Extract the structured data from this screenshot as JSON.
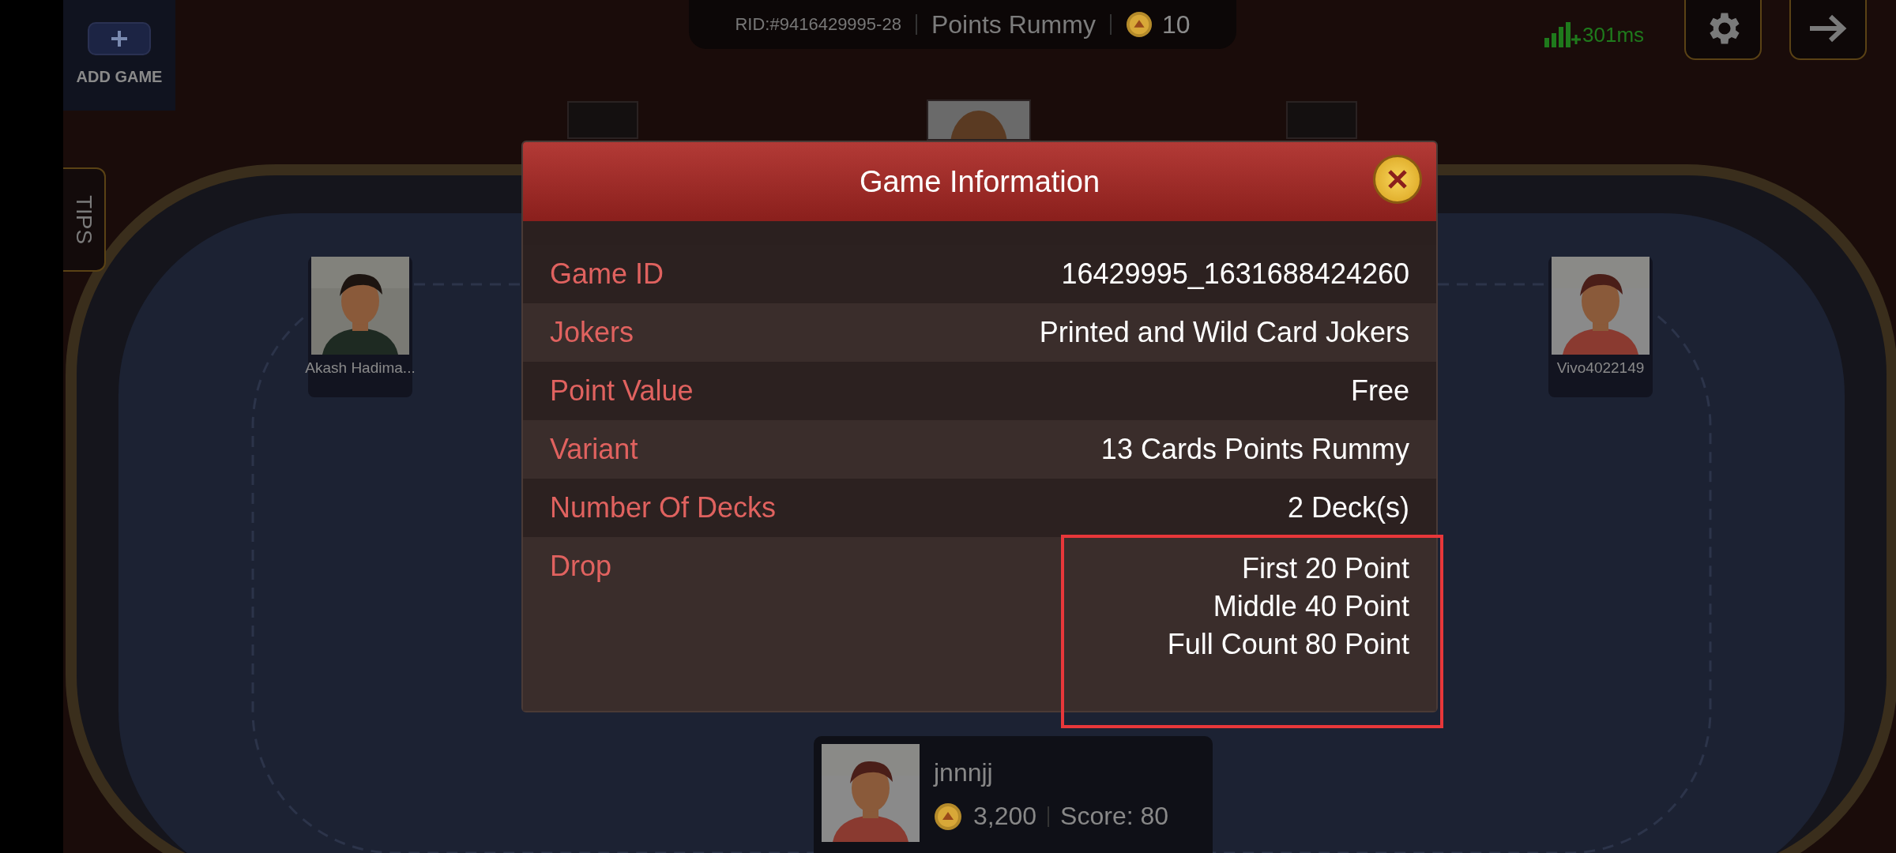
{
  "top_bar": {
    "room_id": "RID:#9416429995-28",
    "game_type": "Points Rummy",
    "coins": "10"
  },
  "add_game": {
    "label": "ADD GAME"
  },
  "tips_tab": {
    "label": "TIPS"
  },
  "network": {
    "latency": "301ms"
  },
  "top_seats": [
    {
      "kind": "empty"
    },
    {
      "kind": "avatar"
    },
    {
      "kind": "empty"
    }
  ],
  "players": [
    {
      "name": "Akash Hadima..."
    },
    {
      "name": "Vivo4022149",
      "kind": "cartoon"
    }
  ],
  "dialog": {
    "title": "Game Information",
    "rows": [
      {
        "label": "Game ID",
        "values": [
          "16429995_1631688424260"
        ],
        "highlighted": false
      },
      {
        "label": "Jokers",
        "values": [
          "Printed and Wild Card Jokers"
        ],
        "highlighted": false
      },
      {
        "label": "Point Value",
        "values": [
          "Free"
        ],
        "highlighted": false
      },
      {
        "label": "Variant",
        "values": [
          "13 Cards Points Rummy"
        ],
        "highlighted": false
      },
      {
        "label": "Number Of Decks",
        "values": [
          "2 Deck(s)"
        ],
        "highlighted": false
      },
      {
        "label": "Drop",
        "values": [
          "First 20 Point",
          "Middle 40 Point",
          "Full Count 80 Point"
        ],
        "highlighted": true
      }
    ]
  },
  "me": {
    "name": "jnnnjj",
    "coins": "3,200",
    "score": "Score: 80"
  }
}
